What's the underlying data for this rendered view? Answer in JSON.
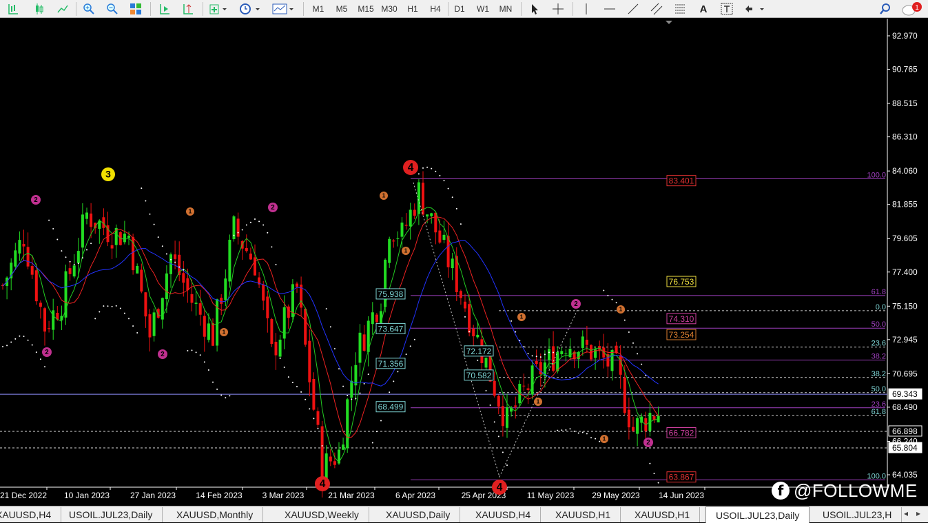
{
  "toolbar": {
    "timeframes": [
      "M1",
      "M5",
      "M15",
      "M30",
      "H1",
      "H4",
      "D1",
      "W1",
      "MN"
    ],
    "notification_count": "1"
  },
  "chart": {
    "symbol": "USOIL.JUL23",
    "timeframe": "Daily",
    "price_axis": [
      "92.970",
      "90.765",
      "88.515",
      "86.310",
      "84.060",
      "81.855",
      "79.605",
      "77.400",
      "75.150",
      "72.945",
      "70.695",
      "68.490",
      "66.240",
      "64.035"
    ],
    "current_price": "69.343",
    "h_line_prices": [
      "66.898",
      "65.804"
    ],
    "date_axis": [
      "21 Dec 2022",
      "10 Jan 2023",
      "27 Jan 2023",
      "14 Feb 2023",
      "3 Mar 2023",
      "21 Mar 2023",
      "6 Apr 2023",
      "25 Apr 2023",
      "11 May 2023",
      "29 May 2023",
      "14 Jun 2023"
    ],
    "price_labels": [
      {
        "text": "75.938",
        "color": "#7fd6d6"
      },
      {
        "text": "73.647",
        "color": "#7fd6d6"
      },
      {
        "text": "71.356",
        "color": "#7fd6d6"
      },
      {
        "text": "68.499",
        "color": "#7fd6d6"
      },
      {
        "text": "72.172",
        "color": "#7fd6d6"
      },
      {
        "text": "70.582",
        "color": "#7fd6d6"
      },
      {
        "text": "83.401",
        "color": "#e03030"
      },
      {
        "text": "76.753",
        "color": "#f0e040"
      },
      {
        "text": "74.310",
        "color": "#d040a0"
      },
      {
        "text": "73.254",
        "color": "#e08030"
      },
      {
        "text": "66.782",
        "color": "#d040a0"
      },
      {
        "text": "63.867",
        "color": "#e03030"
      }
    ],
    "fib_levels": [
      {
        "text": "100.0",
        "color": "#a040c0"
      },
      {
        "text": "61.8",
        "color": "#a040c0"
      },
      {
        "text": "0.0",
        "color": "#7fd6d6"
      },
      {
        "text": "50.0",
        "color": "#a040c0"
      },
      {
        "text": "23.6",
        "color": "#7fd6d6"
      },
      {
        "text": "38.2",
        "color": "#a040c0"
      },
      {
        "text": "38.2",
        "color": "#7fd6d6"
      },
      {
        "text": "50.0",
        "color": "#7fd6d6"
      },
      {
        "text": "23.6",
        "color": "#a040c0"
      },
      {
        "text": "61.8",
        "color": "#7fd6d6"
      },
      {
        "text": "100.0",
        "color": "#7fd6d6"
      }
    ],
    "wave_labels": [
      {
        "text": "3",
        "color": "#f0e000",
        "text_color": "#000"
      },
      {
        "text": "4",
        "color": "#e02020",
        "text_color": "#000"
      },
      {
        "text": "4",
        "color": "#e02020",
        "text_color": "#000"
      },
      {
        "text": "4",
        "color": "#e02020",
        "text_color": "#000"
      },
      {
        "text": "2",
        "color": "#c03090",
        "text_color": "#000"
      },
      {
        "text": "2",
        "color": "#c03090",
        "text_color": "#000"
      },
      {
        "text": "2",
        "color": "#c03090",
        "text_color": "#000"
      },
      {
        "text": "2",
        "color": "#c03090",
        "text_color": "#000"
      },
      {
        "text": "2",
        "color": "#c03090",
        "text_color": "#000"
      },
      {
        "text": "2",
        "color": "#c03090",
        "text_color": "#000"
      },
      {
        "text": "1",
        "color": "#d07030",
        "text_color": "#000"
      },
      {
        "text": "1",
        "color": "#d07030",
        "text_color": "#000"
      },
      {
        "text": "1",
        "color": "#d07030",
        "text_color": "#000"
      },
      {
        "text": "1",
        "color": "#d07030",
        "text_color": "#000"
      },
      {
        "text": "1",
        "color": "#d07030",
        "text_color": "#000"
      },
      {
        "text": "1",
        "color": "#d07030",
        "text_color": "#000"
      },
      {
        "text": "1",
        "color": "#d07030",
        "text_color": "#000"
      },
      {
        "text": "1",
        "color": "#d07030",
        "text_color": "#000"
      }
    ],
    "colors": {
      "bull": "#22dd22",
      "bear": "#ee1111",
      "ma_fast": "#22cc22",
      "ma_mid": "#ee2222",
      "ma_slow": "#2233ff"
    }
  },
  "watermark": "@FOLLOWME",
  "tabs": [
    "XAUUSD,H4",
    "USOIL.JUL23,Daily",
    "XAUUSD,Monthly",
    "XAUUSD,Weekly",
    "XAUUSD,Daily",
    "XAUUSD,H4",
    "XAUUSD,H1",
    "XAUUSD,H1",
    "USOIL.JUL23,Daily",
    "USOIL.JUL23,H"
  ],
  "active_tab_index": 8
}
